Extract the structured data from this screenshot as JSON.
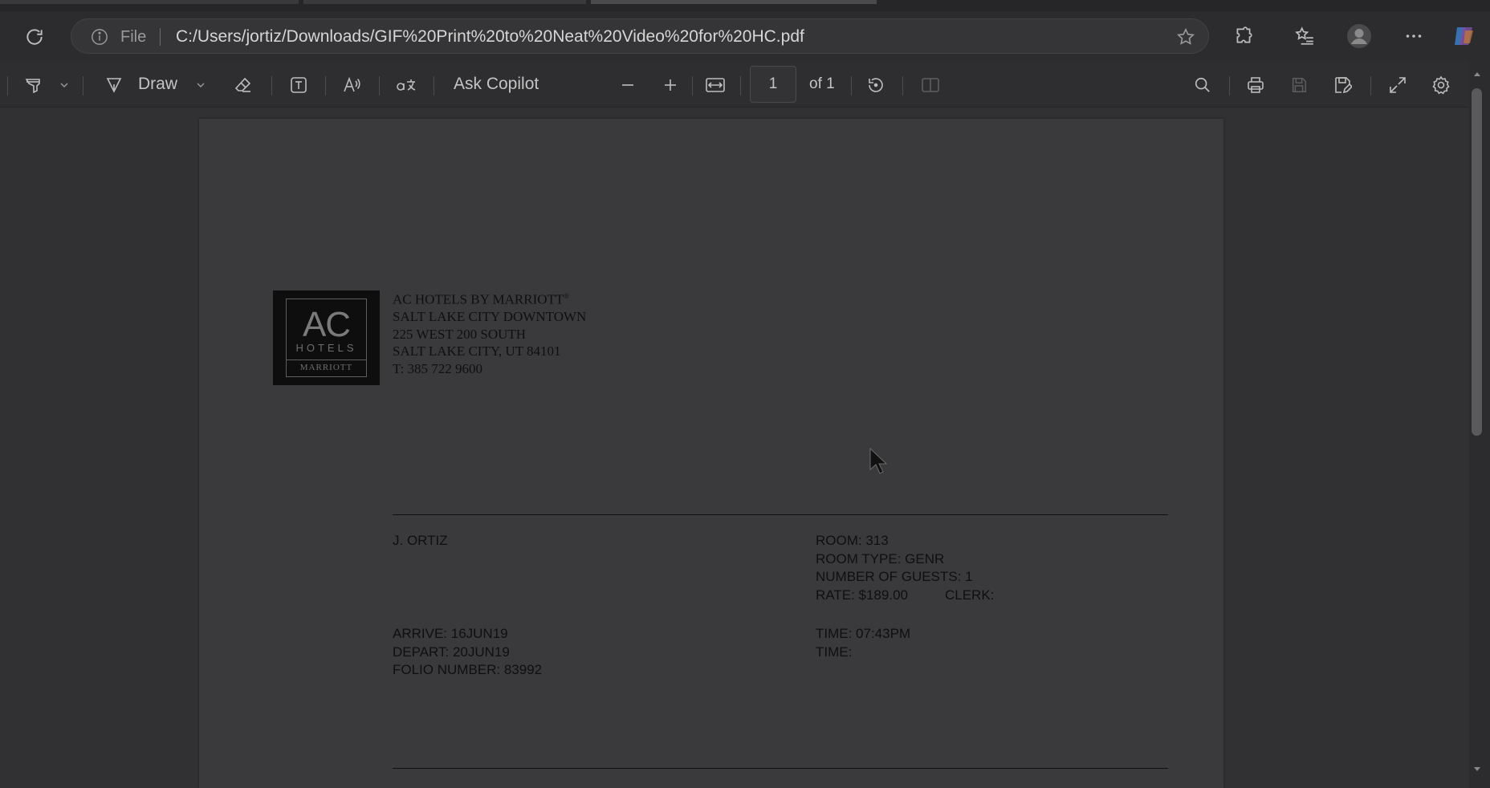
{
  "browser": {
    "omnibox": {
      "scheme_label": "File",
      "url": "C:/Users/jortiz/Downloads/GIF%20Print%20to%20Neat%20Video%20for%20HC.pdf"
    }
  },
  "pdf_toolbar": {
    "draw_label": "Draw",
    "ask_copilot_label": "Ask Copilot",
    "page_number": "1",
    "page_total_label": "of 1"
  },
  "document": {
    "logo": {
      "ac": "AC",
      "hotels": "HOTELS",
      "marriott": "MARRIOTT"
    },
    "hotel": {
      "name": "AC HOTELS BY MARRIOTT",
      "name_mark": "®",
      "line2": "SALT LAKE CITY DOWNTOWN",
      "line3": "225 WEST 200 SOUTH",
      "line4": "SALT LAKE CITY, UT 84101",
      "line5": "T: 385 722 9600"
    },
    "guest_name": "J. ORTIZ",
    "room": "ROOM: 313",
    "room_type": "ROOM TYPE: GENR",
    "guests": "NUMBER OF GUESTS: 1",
    "rate": "RATE: $189.00",
    "clerk": "CLERK:",
    "arrive": "ARRIVE: 16JUN19",
    "depart": "DEPART: 20JUN19",
    "folio": "FOLIO NUMBER: 83992",
    "time_in": "TIME: 07:43PM",
    "time_out": "TIME:"
  }
}
